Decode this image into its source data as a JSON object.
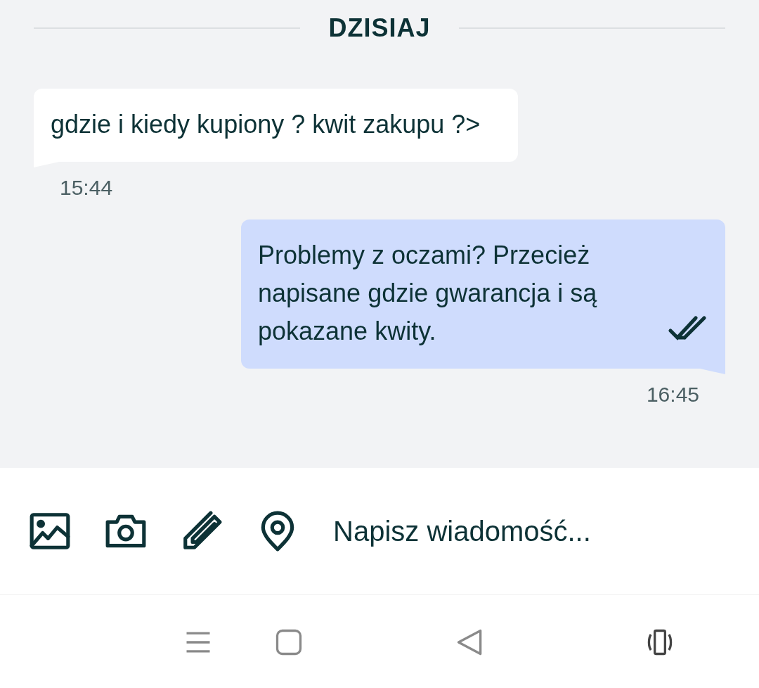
{
  "date_divider": "DZISIAJ",
  "messages": [
    {
      "kind": "incoming",
      "text": "gdzie i kiedy kupiony ? kwit zakupu ?>",
      "time": "15:44"
    },
    {
      "kind": "outgoing",
      "text": "Problemy z oczami? Przecież napisane gdzie gwarancja i są pokazane kwity.",
      "time": "16:45",
      "read": true
    }
  ],
  "composer": {
    "placeholder": "Napisz wiadomość..."
  }
}
